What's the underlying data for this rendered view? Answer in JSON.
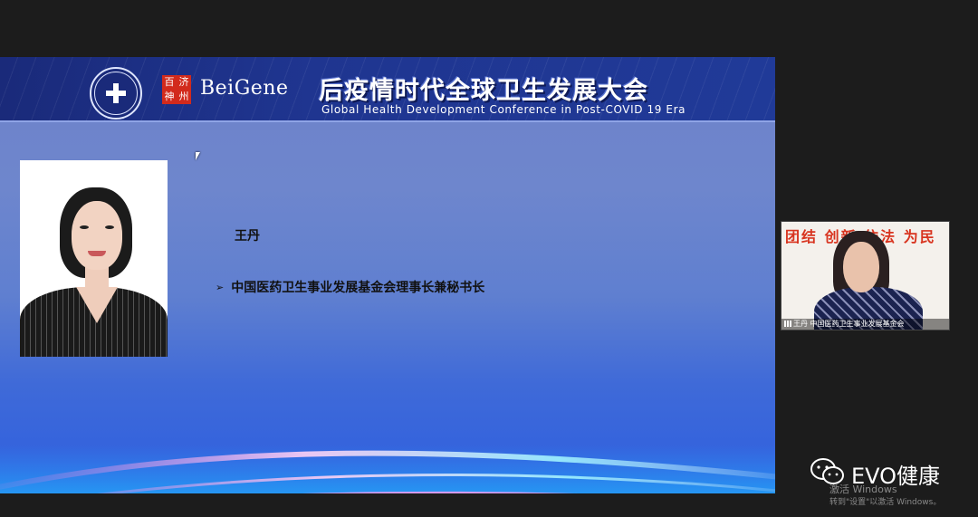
{
  "slide": {
    "brand": "BeiGene",
    "seal_chars": [
      "百",
      "济",
      "神",
      "州"
    ],
    "conference_title_cn": "后疫情时代全球卫生发展大会",
    "conference_title_en": "Global Health Development Conference in Post-COVID 19 Era",
    "speaker_name": "王丹",
    "speaker_title": "中国医药卫生事业发展基金会理事长兼秘书长"
  },
  "video_tile": {
    "wall_text": "团结 创新 依法 为民",
    "caption": "王丹 中国医药卫生事业发展基金会"
  },
  "watermark": {
    "text": "EVO健康",
    "icon": "wechat-icon"
  },
  "windows_activation": {
    "line1": "激活 Windows",
    "line2": "转到\"设置\"以激活 Windows。"
  },
  "colors": {
    "banner": "#1f3590",
    "slide_bg": "#6e86cd",
    "seal_red": "#d22a1c",
    "wall_red": "#d8341f",
    "background": "#1c1c1c"
  }
}
